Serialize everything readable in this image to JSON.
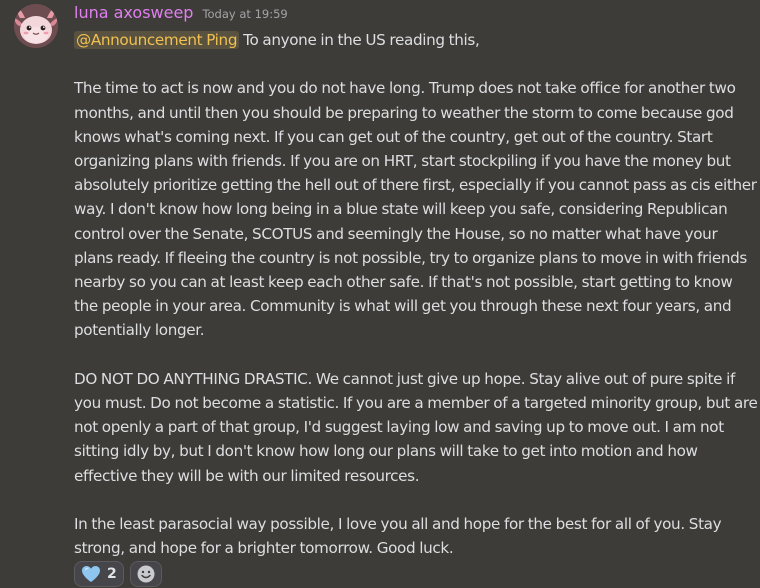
{
  "message": {
    "author": "luna axosweep",
    "timestamp": "Today at 19:59",
    "mention": "@Announcement Ping",
    "first_line": " To anyone in the US reading this,",
    "paragraphs": [
      "The time to act is now and you do not have long. Trump does not take office for another two months, and until then you should be preparing to weather the storm to come because god knows what's coming next. If you can get out of the country, get out of the country. Start organizing plans with friends. If you are on HRT, start stockpiling if you have the money but absolutely prioritize getting the hell out of there first, especially if you cannot pass as cis either way. I don't know how long being in a blue state will keep you safe, considering Republican control over the Senate, SCOTUS and seemingly the House, so no matter what have your plans ready. If fleeing the country is not possible, try to organize plans to move in with friends nearby so you can at least keep each other safe. If that's not possible, start getting to know the people in your area. Community is what will get you through these next four years, and potentially longer.",
      "DO NOT DO ANYTHING DRASTIC. We cannot just give up hope. Stay alive out of pure spite if you must. Do not become a statistic. If you are a member of a targeted minority group, but are not openly a part of that group, I'd suggest laying low and saving up to move out. I am not sitting idly by, but I don't know how long our plans will take to get into motion and how effective they will be with our limited resources.",
      "In the least parasocial way possible, I love you all and hope for the best for all of you. Stay strong, and hope for a brighter tomorrow. Good luck."
    ]
  },
  "reactions": [
    {
      "icon": "blue-heart-icon",
      "count": "2"
    }
  ],
  "add_reaction_icon": "smile-icon",
  "colors": {
    "background": "#3d3c38",
    "username": "#e07ff0",
    "mention_text": "#f0c150",
    "mention_bg": "#5a5240",
    "heart": "#8fc6ef"
  }
}
